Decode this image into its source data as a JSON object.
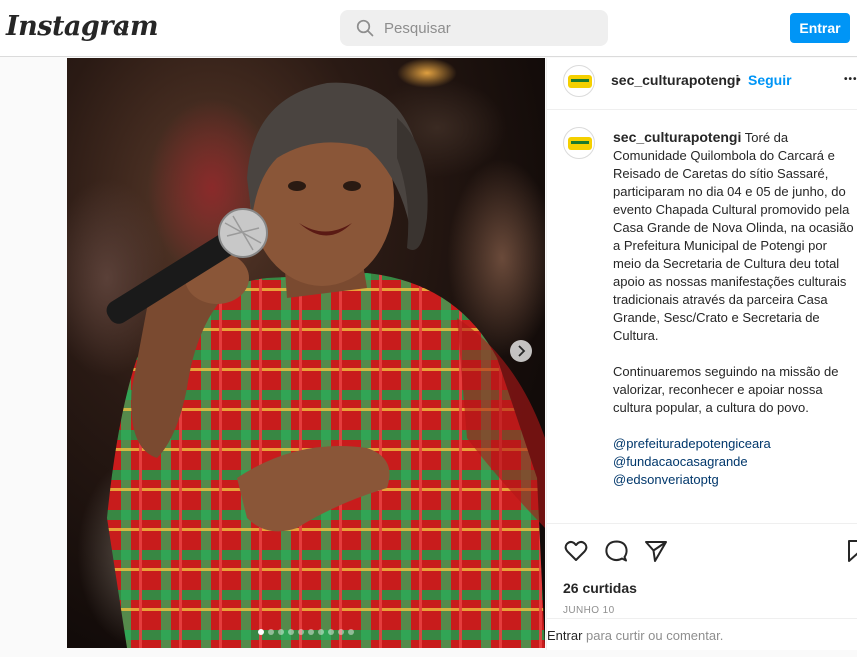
{
  "app": {
    "logo_text": "Instagram"
  },
  "search": {
    "placeholder": "Pesquisar"
  },
  "nav": {
    "login_label": "Entrar"
  },
  "post": {
    "username": "sec_culturapotengi",
    "separator": "•",
    "follow_label": "Seguir",
    "more_label": "•••",
    "caption_paragraph_1": "Toré da Comunidade Quilombola do Carcará e Reisado de Caretas do sítio Sassaré, participaram no dia 04 e 05 de junho, do evento Chapada Cultural promovido pela Casa Grande de Nova Olinda, na ocasião a Prefeitura Municipal de Potengi por meio da Secretaria de Cultura deu total apoio as nossas manifestações culturais tradicionais através da parceira Casa Grande, Sesc/Crato e Secretaria de Cultura.",
    "caption_paragraph_2": "Continuaremos seguindo na missão de valorizar, reconhecer e apoiar nossa cultura popular, a cultura do povo.",
    "mentions": [
      "@prefeituradepotengiceara",
      "@fundacaocasagrande",
      "@edsonveriatoptg"
    ],
    "likes": "26 curtidas",
    "date": "JUNHO 10",
    "comment_link": "Entrar",
    "comment_prompt": " para curtir ou comentar.",
    "carousel_total": 10,
    "carousel_active": 1
  },
  "icons": {
    "logo_chevron": "chevron-down-icon",
    "search": "search-icon",
    "like": "heart-icon",
    "comment": "comment-icon",
    "share": "paper-plane-icon",
    "save": "bookmark-icon",
    "next": "chevron-right-icon"
  },
  "colors": {
    "accent": "#0095f6",
    "mention": "#00376b",
    "muted": "#8e8e8e"
  }
}
